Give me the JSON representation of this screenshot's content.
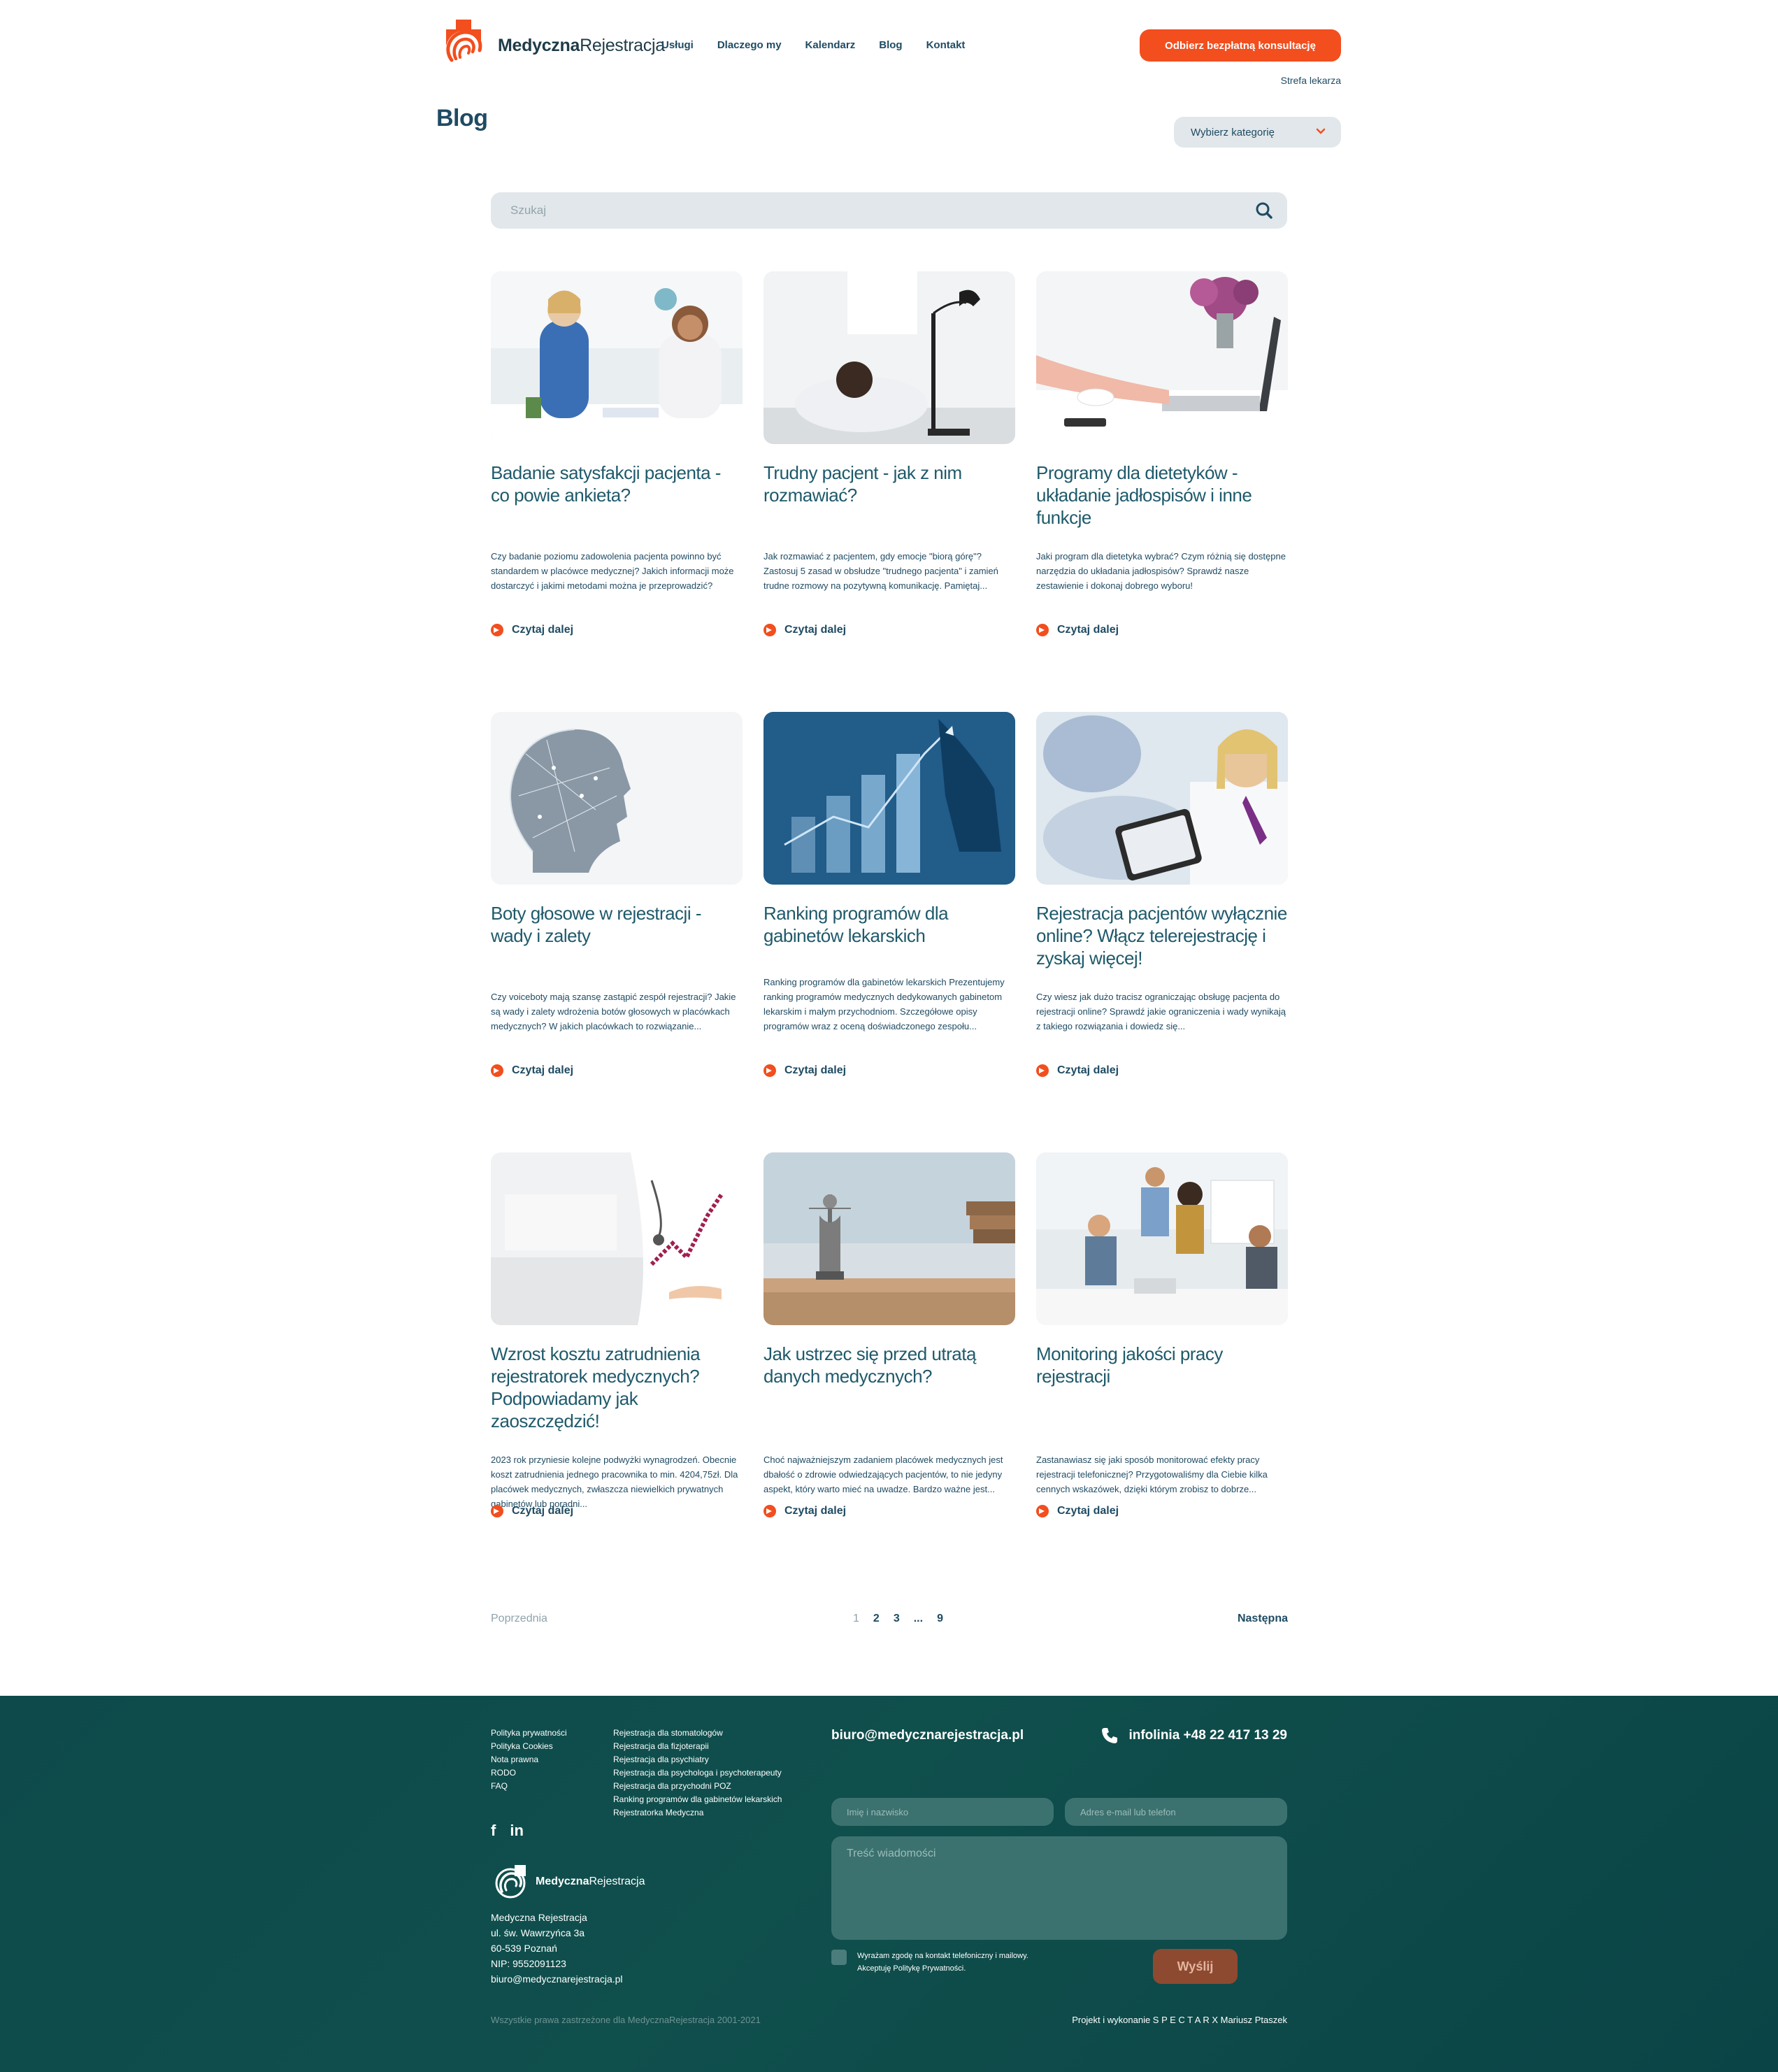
{
  "brand": {
    "name_bold": "Medyczna",
    "name_light": "Rejestracja",
    "accent": "#f24e1e",
    "primary": "#1f4b63"
  },
  "nav": {
    "items": [
      "Usługi",
      "Dlaczego my",
      "Kalendarz",
      "Blog",
      "Kontakt"
    ]
  },
  "header": {
    "cta_label": "Odbierz bezpłatną konsultację",
    "doctor_zone": "Strefa lekarza"
  },
  "page": {
    "title": "Blog",
    "category_select": "Wybierz kategorię",
    "search_placeholder": "Szukaj"
  },
  "posts": [
    {
      "title": "Badanie satysfakcji pacjenta - co powie ankieta?",
      "excerpt": "Czy badanie poziomu zadowolenia pacjenta powinno być standardem w placówce medycznej? Jakich informacji może dostarczyć i jakimi metodami można je przeprowadzić?",
      "more": "Czytaj dalej"
    },
    {
      "title": "Trudny pacjent - jak z nim rozmawiać?",
      "excerpt": "Jak rozmawiać z pacjentem, gdy emocje \"biorą górę\"? Zastosuj 5 zasad w obsłudze \"trudnego pacjenta\" i zamień trudne rozmowy na pozytywną komunikację. Pamiętaj...",
      "more": "Czytaj dalej"
    },
    {
      "title": "Programy dla dietetyków - układanie jadłospisów i inne funkcje",
      "excerpt": "Jaki program dla dietetyka wybrać? Czym różnią się dostępne narzędzia do układania jadłospisów? Sprawdź nasze zestawienie i dokonaj dobrego wyboru!",
      "more": "Czytaj dalej"
    },
    {
      "title": "Boty głosowe w rejestracji - wady i zalety",
      "excerpt": "Czy voiceboty mają szansę zastąpić zespół rejestracji? Jakie są wady i zalety wdrożenia botów głosowych w placówkach medycznych? W jakich placówkach to rozwiązanie...",
      "more": "Czytaj dalej"
    },
    {
      "title": "Ranking programów dla gabinetów lekarskich",
      "excerpt": "Ranking programów dla gabinetów lekarskich Prezentujemy ranking programów medycznych dedykowanych gabinetom lekarskim i małym przychodniom. Szczegółowe opisy programów wraz z oceną doświadczonego zespołu...",
      "more": "Czytaj dalej"
    },
    {
      "title": "Rejestracja pacjentów wyłącznie online? Włącz telerejestrację i zyskaj więcej!",
      "excerpt": "Czy wiesz jak dużo tracisz ograniczając obsługę pacjenta do rejestracji online? Sprawdź jakie ograniczenia i wady wynikają z takiego rozwiązania i dowiedz się...",
      "more": "Czytaj dalej"
    },
    {
      "title": "Wzrost kosztu zatrudnienia rejestratorek medycznych? Podpowiadamy jak zaoszczędzić!",
      "excerpt": "2023 rok przyniesie kolejne podwyżki wynagrodzeń. Obecnie koszt zatrudnienia jednego pracownika to min. 4204,75zł. Dla placówek medycznych, zwłaszcza niewielkich prywatnych gabinetów lub poradni...",
      "more": "Czytaj dalej"
    },
    {
      "title": "Jak ustrzec się przed utratą danych medycznych?",
      "excerpt": "Choć najważniejszym zadaniem placówek medycznych jest dbałość o zdrowie odwiedzających pacjentów, to nie jedyny aspekt, który warto mieć na uwadze. Bardzo ważne jest...",
      "more": "Czytaj dalej"
    },
    {
      "title": "Monitoring jakości pracy rejestracji",
      "excerpt": "Zastanawiasz się jaki sposób monitorować efekty pracy rejestracji telefonicznej? Przygotowaliśmy dla Ciebie kilka cennych wskazówek, dzięki którym zrobisz to dobrze...",
      "more": "Czytaj dalej"
    }
  ],
  "pagination": {
    "prev": "Poprzednia",
    "next": "Następna",
    "pages": [
      "1",
      "2",
      "3",
      "...",
      "9"
    ],
    "current": "1"
  },
  "footer": {
    "links_col1": [
      "Polityka prywatności",
      "Polityka Cookies",
      "Nota prawna",
      "RODO",
      "FAQ"
    ],
    "links_col2": [
      "Rejestracja dla stomatologów",
      "Rejestracja dla fizjoterapii",
      "Rejestracja dla psychiatry",
      "Rejestracja dla psychologa i psychoterapeuty",
      "Rejestracja dla przychodni POZ",
      "Ranking programów dla gabinetów lekarskich",
      "Rejestratorka Medyczna"
    ],
    "social": [
      "f",
      "in"
    ],
    "address": [
      "Medyczna Rejestracja",
      "ul. św. Wawrzyńca 3a",
      "60-539 Poznań",
      "NIP: 9552091123",
      "biuro@medycznarejestracja.pl"
    ],
    "email": "biuro@medycznarejestracja.pl",
    "phone": "infolinia +48 22 417 13 29",
    "form": {
      "name_placeholder": "Imię i nazwisko",
      "contact_placeholder": "Adres e-mail lub telefon",
      "message_placeholder": "Treść wiadomości",
      "consent_line1": "Wyrażam zgodę na kontakt telefoniczny i mailowy.",
      "consent_line2": "Akceptuję Politykę Prywatności.",
      "send_label": "Wyślij"
    },
    "copyright": "Wszystkie prawa zastrzeżone dla MedycznaRejestracja 2001-2021",
    "credit": "Projekt i wykonanie S P E C T A R X Mariusz Ptaszek",
    "bg_color": "#0e4a4b"
  }
}
